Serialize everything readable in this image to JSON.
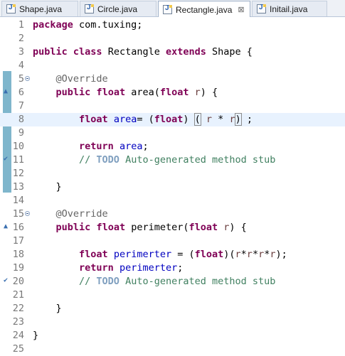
{
  "tabs": [
    {
      "label": "Shape.java",
      "active": false
    },
    {
      "label": "Circle.java",
      "active": false
    },
    {
      "label": "Rectangle.java",
      "active": true,
      "close": "⊠"
    },
    {
      "label": "Initail.java",
      "active": false
    }
  ],
  "editor": {
    "lines": [
      {
        "n": "1",
        "text": "package com.tuxing;"
      },
      {
        "n": "2",
        "text": ""
      },
      {
        "n": "3",
        "text": "public class Rectangle extends Shape {"
      },
      {
        "n": "4",
        "text": ""
      },
      {
        "n": "5",
        "text": "    @Override"
      },
      {
        "n": "6",
        "text": "    public float area(float r) {"
      },
      {
        "n": "7",
        "text": ""
      },
      {
        "n": "8",
        "text": "        float area= (float) ( r * r) ;"
      },
      {
        "n": "9",
        "text": ""
      },
      {
        "n": "10",
        "text": "        return area;"
      },
      {
        "n": "11",
        "text": "        // TODO Auto-generated method stub"
      },
      {
        "n": "12",
        "text": ""
      },
      {
        "n": "13",
        "text": "    }"
      },
      {
        "n": "14",
        "text": ""
      },
      {
        "n": "15",
        "text": "    @Override"
      },
      {
        "n": "16",
        "text": "    public float perimeter(float r) {"
      },
      {
        "n": "17",
        "text": ""
      },
      {
        "n": "18",
        "text": "        float perimerter = (float)(r*r*r*r);"
      },
      {
        "n": "19",
        "text": "        return perimerter;"
      },
      {
        "n": "20",
        "text": "        // TODO Auto-generated method stub"
      },
      {
        "n": "21",
        "text": ""
      },
      {
        "n": "22",
        "text": "    }"
      },
      {
        "n": "23",
        "text": ""
      },
      {
        "n": "24",
        "text": "}"
      },
      {
        "n": "25",
        "text": ""
      }
    ]
  },
  "colors": {
    "keyword": "#7f0055",
    "annotation": "#646464",
    "local_variable": "#0000c0",
    "parameter": "#6a3e3e",
    "comment": "#3f7f5f",
    "todo_tag": "#7f9fbf",
    "current_line": "#e8f2fe",
    "change_ruler": "#7fb6cc"
  }
}
